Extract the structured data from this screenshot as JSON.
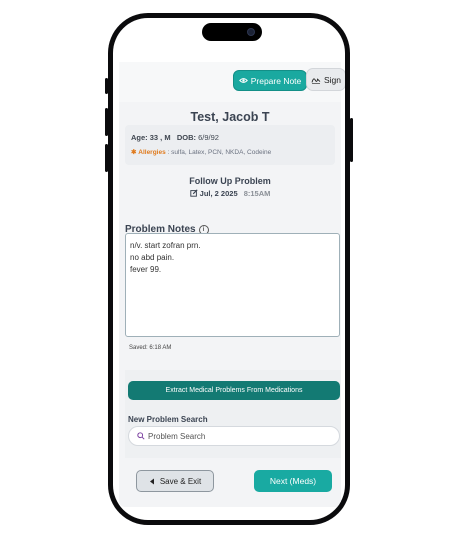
{
  "header": {
    "prepare_note_label": "Prepare Note",
    "sign_label": "Sign"
  },
  "patient": {
    "name": "Test, Jacob T",
    "age_sex": "Age: 33 , M",
    "dob_label": "DOB:",
    "dob": "6/9/92",
    "allergies_label": "Allergies",
    "allergies_sep": " : ",
    "allergies": "sulfa, Latex, PCN, NKDA, Codeine"
  },
  "visit": {
    "type": "Follow Up Problem",
    "date": "Jul, 2 2025",
    "time": "8:15AM"
  },
  "notes": {
    "title": "Problem Notes",
    "info_glyph": "i",
    "lines": [
      "n/v. start zofran prn.",
      "no abd pain.",
      "fever 99."
    ],
    "saved_status": "Saved: 6:18 AM"
  },
  "actions": {
    "extract_label": "Extract Medical Problems From Medications",
    "search_label": "New Problem Search",
    "search_placeholder": "Problem Search",
    "back_label": "Save & Exit",
    "next_label": "Next (Meds)"
  },
  "colors": {
    "teal": "#1aa9a0",
    "dark_teal": "#137a73",
    "allergy_orange": "#e07b1e"
  },
  "icons": [
    "eye-icon",
    "signature-icon",
    "asterisk-icon",
    "edit-calendar-icon",
    "info-icon",
    "search-icon",
    "back-arrow-icon"
  ]
}
